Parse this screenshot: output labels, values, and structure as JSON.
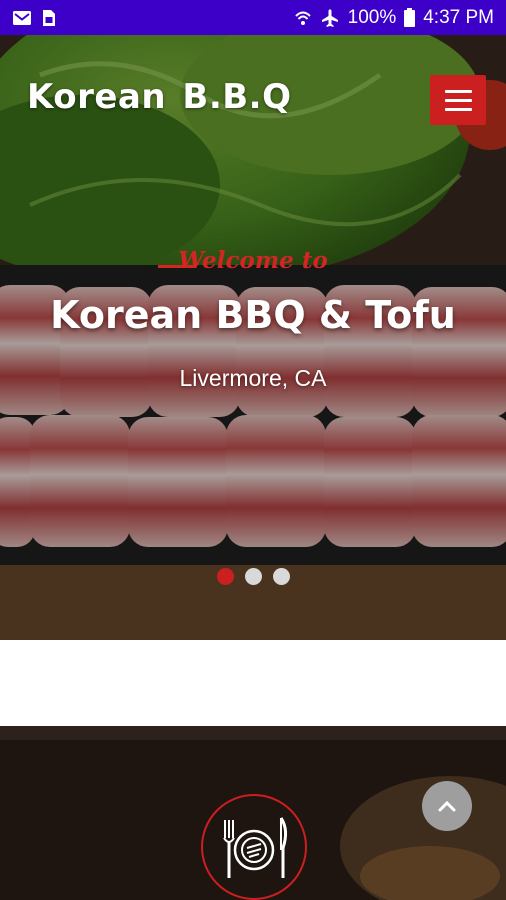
{
  "status_bar": {
    "battery": "100%",
    "time": "4:37 PM",
    "icons": [
      "gmail-icon",
      "sim-card-icon",
      "wifi-icon",
      "airplane-mode-icon",
      "battery-icon"
    ],
    "color": "#3c00c8"
  },
  "header": {
    "brand": "Korean B.B.Q",
    "menu_icon": "hamburger-menu-icon",
    "menu_button_color": "#cc1f1f"
  },
  "hero": {
    "welcome": "Welcome to",
    "title": "Korean BBQ & Tofu",
    "subtitle": "Livermore, CA",
    "accent_color": "#d42525",
    "slides": [
      {
        "active": true
      },
      {
        "active": false
      },
      {
        "active": false
      }
    ]
  },
  "section": {
    "icon": "plate-fork-knife-icon"
  },
  "scroll_top": {
    "icon": "chevron-up-icon"
  }
}
